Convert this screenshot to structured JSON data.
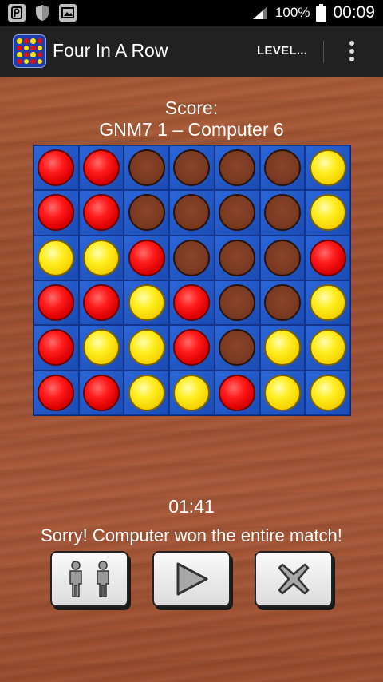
{
  "status_bar": {
    "battery": "100%",
    "time": "00:09"
  },
  "app_bar": {
    "title": "Four In A Row",
    "level_button": "LEVEL..."
  },
  "game": {
    "score_label": "Score:",
    "score_value": "GNM7 1 – Computer 6",
    "board": [
      [
        "red",
        "red",
        "empty",
        "empty",
        "empty",
        "empty",
        "yellow"
      ],
      [
        "red",
        "red",
        "empty",
        "empty",
        "empty",
        "empty",
        "yellow"
      ],
      [
        "yellow",
        "yellow",
        "red",
        "empty",
        "empty",
        "empty",
        "red"
      ],
      [
        "red",
        "red",
        "yellow",
        "red",
        "empty",
        "empty",
        "yellow"
      ],
      [
        "red",
        "yellow",
        "yellow",
        "red",
        "empty",
        "yellow",
        "yellow"
      ],
      [
        "red",
        "red",
        "yellow",
        "yellow",
        "red",
        "yellow",
        "yellow"
      ]
    ],
    "timer": "01:41",
    "message": "Sorry! Computer won the entire match!"
  },
  "controls": {
    "players_icon": "two-players-icon",
    "play_icon": "play-icon",
    "close_icon": "close-icon"
  },
  "colors": {
    "red": "#ff1a1a",
    "yellow": "#ffee22",
    "board_blue": "#1d55c9"
  }
}
